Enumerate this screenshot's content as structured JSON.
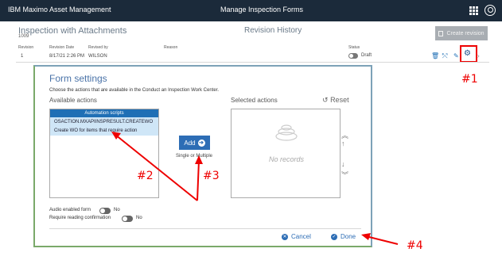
{
  "topbar": {
    "brand": "IBM Maximo Asset Management",
    "title": "Manage Inspection Forms"
  },
  "record": {
    "title": "Inspection with Attachments",
    "id": "1009"
  },
  "section_title": "Revision History",
  "create_revision_label": "Create revision",
  "table": {
    "headers": [
      "Revision",
      "Revision Date",
      "Revised by",
      "Reason",
      "Status"
    ],
    "row": {
      "revision": "1",
      "date": "8/17/21 2:26 PM",
      "revised_by": "WILSON",
      "status": "Draft"
    }
  },
  "dialog": {
    "title": "Form settings",
    "description": "Choose the actions that are available in the Conduct an Inspection Work Center.",
    "available_label": "Available actions",
    "available_header": "Automation scripts",
    "available_items": [
      "OSACTION.MXAPIINSPRESULT.CREATEWO",
      "Create WO for items that require action"
    ],
    "add_label": "Add",
    "single_multiple": "Single or Multiple",
    "selected_label": "Selected actions",
    "reset_label": "Reset",
    "no_records": "No records",
    "audio_label": "Audio enabled form",
    "audio_value": "No",
    "confirm_label": "Require reading confirmation",
    "confirm_value": "No",
    "cancel_label": "Cancel",
    "done_label": "Done"
  },
  "annotations": [
    "#1",
    "#2",
    "#3",
    "#4"
  ],
  "colors": {
    "topbar": "#1b2a3a",
    "accent": "#2d6db5",
    "annotation": "#e00000"
  }
}
